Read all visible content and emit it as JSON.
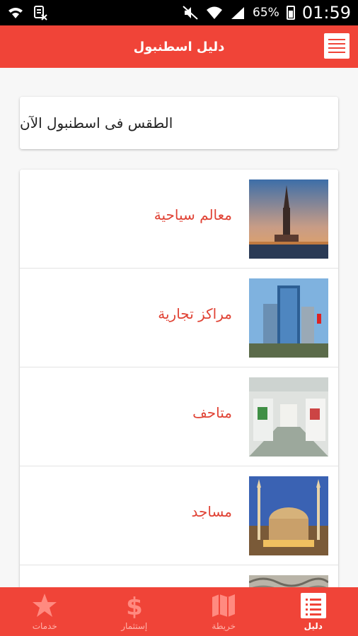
{
  "status_bar": {
    "battery": "65%",
    "time": "01:59"
  },
  "app_bar": {
    "title": "دليل اسطنبول"
  },
  "weather_card": {
    "text": "الطقس فى اسطنبول الآن"
  },
  "list": {
    "items": [
      {
        "label": "معالم سياحية"
      },
      {
        "label": "مراكز تجارية"
      },
      {
        "label": "متاحف"
      },
      {
        "label": "مساجد"
      },
      {
        "label": ""
      }
    ]
  },
  "bottom_nav": {
    "tabs": [
      {
        "label": "دليل",
        "icon": "list-icon",
        "active": true
      },
      {
        "label": "خريطة",
        "icon": "map-icon"
      },
      {
        "label": "إستثمار",
        "icon": "dollar-icon"
      },
      {
        "label": "خدمات",
        "icon": "star-icon"
      }
    ]
  },
  "colors": {
    "primary": "#f04438",
    "accent_text": "#e04234"
  }
}
